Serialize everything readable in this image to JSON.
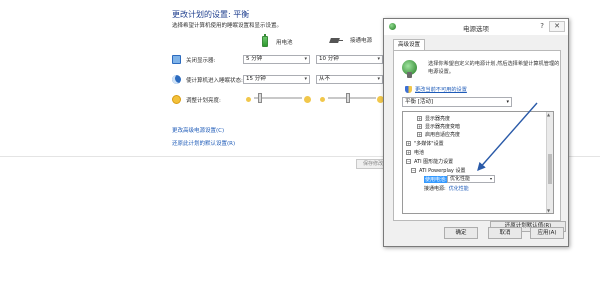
{
  "page": {
    "title": "更改计划的设置: 平衡",
    "description": "选择希望计算机使用的睡眠设置和显示设置。",
    "columns": {
      "battery": "用电池",
      "plugged": "接通电源"
    },
    "rows": [
      {
        "label": "关闭显示器:",
        "icon": "monitor-icon",
        "battery": "5 分钟",
        "plugged": "10 分钟"
      },
      {
        "label": "使计算机进入睡眠状态:",
        "icon": "moon-icon",
        "battery": "15 分钟",
        "plugged": "从不"
      },
      {
        "label": "调整计划亮度:",
        "icon": "sun-icon"
      }
    ],
    "links": {
      "advanced": "更改高级电源设置(C)",
      "restore": "还原此计划的默认设置(R)"
    },
    "save_button": "保存修改"
  },
  "dialog": {
    "title": "电源选项",
    "help": "?",
    "close": "✕",
    "tab": "高级设置",
    "description": "选择你希望自定义的电源计划,然后选择希望计算机管理的电源设置。",
    "unavailable_link": "更改当前不可用的设置",
    "plan_selected": "平衡 [活动]",
    "tree": [
      "显示器亮度",
      "显示器亮度变暗",
      "启用自适应亮度",
      "\"多媒体\"设置",
      "电池",
      "ATI 图形能力设置",
      "ATI Powerplay 设置",
      "使用电池:",
      "接通电源:"
    ],
    "tree_values": {
      "battery": "优化性能",
      "plugged": "优化性能"
    },
    "restore_button": "还原计划默认值(R)",
    "ok": "确定",
    "cancel": "取消",
    "apply": "应用(A)"
  },
  "colors": {
    "accent": "#1e5bb8",
    "arrow": "#2a5aa8",
    "selection": "#3399ff"
  }
}
